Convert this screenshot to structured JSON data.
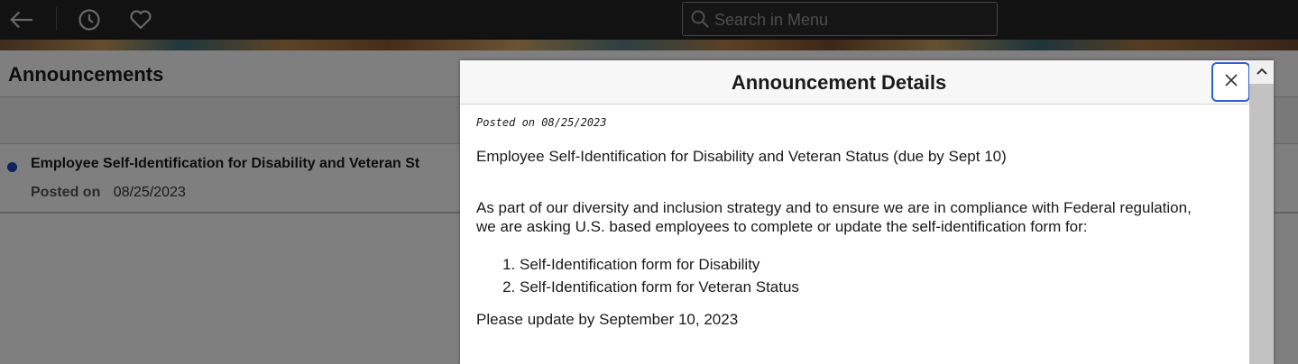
{
  "topbar": {
    "back_icon": "arrow-left-icon",
    "history_icon": "clock-icon",
    "favorites_icon": "heart-icon",
    "search_placeholder": "Search in Menu",
    "search_icon": "search-icon"
  },
  "page": {
    "title": "Announcements",
    "items": [
      {
        "title": "Employee Self-Identification for Disability and Veteran St",
        "posted_label": "Posted on",
        "posted_date": "08/25/2023"
      }
    ]
  },
  "modal": {
    "title": "Announcement Details",
    "close_icon": "close-icon",
    "posted": "Posted on 08/25/2023",
    "headline": "Employee Self-Identification for Disability and Veteran Status (due by Sept 10)",
    "paragraph_line1": "As part of our diversity and inclusion strategy and to ensure we are in compliance with Federal regulation,",
    "paragraph_line2": "we are asking U.S. based employees to complete or update the self-identification form for:",
    "list": [
      "Self-Identification form for Disability",
      "Self-Identification form for Veteran Status"
    ],
    "closing": "Please update by September 10, 2023"
  },
  "colors": {
    "topbar": "#252525",
    "accent_dot": "#2346b8",
    "focus_ring": "#2d63c8"
  }
}
